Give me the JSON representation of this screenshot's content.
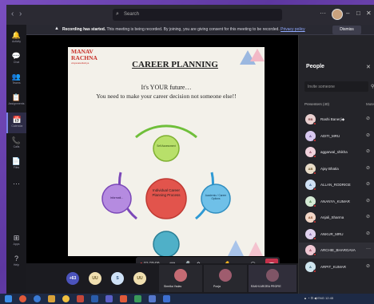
{
  "titlebar": {
    "search_placeholder": "Search"
  },
  "rail": [
    {
      "icon": "activity-icon",
      "glyph": "🔔",
      "label": "Activity"
    },
    {
      "icon": "chat-icon",
      "glyph": "💬",
      "label": "Chat"
    },
    {
      "icon": "teams-icon",
      "glyph": "👥",
      "label": "Teams"
    },
    {
      "icon": "assignments-icon",
      "glyph": "📋",
      "label": "Assignments"
    },
    {
      "icon": "calendar-icon",
      "glyph": "📅",
      "label": "Calendar"
    },
    {
      "icon": "calls-icon",
      "glyph": "📞",
      "label": "Calls"
    },
    {
      "icon": "files-icon",
      "glyph": "📄",
      "label": "Files"
    },
    {
      "icon": "more-icon",
      "glyph": "···",
      "label": ""
    },
    {
      "icon": "apps-icon",
      "glyph": "⊞",
      "label": "Apps"
    },
    {
      "icon": "help-icon",
      "glyph": "?",
      "label": "Help"
    }
  ],
  "banner": {
    "bold": "Recording has started.",
    "text": " This meeting is being recorded. By joining, you are giving consent for this meeting to be recorded.",
    "link": "Privacy policy",
    "dismiss": "Dismiss"
  },
  "slide": {
    "logo_line1": "MANAV",
    "logo_line2": "RACHNA",
    "logo_tag": "vidyanatarikshya",
    "title": "CAREER PLANNING",
    "subtitle1": "It's YOUR future…",
    "subtitle2": "You need to make your career decision not someone else!!",
    "center": "Individual Career Planning Process",
    "node_top": "Self Assessment",
    "node_right": "Academic / Career Options",
    "node_left": "Informati..."
  },
  "call": {
    "timer": "01:23:09",
    "presenter_label": "RAKHI ARORA PROFIE"
  },
  "strip": {
    "circles": [
      {
        "text": "+63",
        "bg": "#4b53bc",
        "fg": "#ffffff"
      },
      {
        "text": "UU",
        "bg": "#f0dfb0",
        "fg": "#6b5a2b"
      },
      {
        "text": "S",
        "bg": "#cfe2f7",
        "fg": "#2b4f7a"
      },
      {
        "text": "UU",
        "bg": "#f0dfb0",
        "fg": "#6b5a2b"
      }
    ],
    "tiles": [
      "Simrika Yadav",
      "Pooja",
      "RAKHI ARORA PROFIE"
    ]
  },
  "people": {
    "title": "People",
    "invite_placeholder": "Invite someone",
    "presenters_header": "Presenters (40)",
    "mute_all": "Mute all",
    "list": [
      {
        "initials": "RB",
        "name": "Rashi Banerji◆",
        "bg": "#e9d0d0",
        "fg": "#7a3a3a"
      },
      {
        "initials": "A",
        "name": "ADITI_MRU",
        "bg": "#d8c8ef",
        "fg": "#4b3576"
      },
      {
        "initials": "A",
        "name": "aggarwal_shikha",
        "bg": "#f1d2dc",
        "fg": "#7a2e4a"
      },
      {
        "initials": "AB",
        "name": "Ajay Bhatia",
        "bg": "#e8dcc8",
        "fg": "#6b5226"
      },
      {
        "initials": "A",
        "name": "ALLAN_RODRIGE",
        "bg": "#cfe0f4",
        "fg": "#284d7b"
      },
      {
        "initials": "A",
        "name": "ANANYA_KUMAR",
        "bg": "#d4ead4",
        "fg": "#2e6a2e"
      },
      {
        "initials": "AS",
        "name": "Anjali_Sharma",
        "bg": "#f2d6c6",
        "fg": "#7d3f1a"
      },
      {
        "initials": "A",
        "name": "ANKUR_MRU",
        "bg": "#e0d2ee",
        "fg": "#5a3a80"
      },
      {
        "initials": "A",
        "name": "ARCHIE_BHARGAVA",
        "bg": "#f0c8d4",
        "fg": "#7c2240"
      },
      {
        "initials": "A",
        "name": "ARPIT_KUMAR",
        "bg": "#cfe5ee",
        "fg": "#24566a"
      }
    ]
  },
  "tray": {
    "time": "12:45"
  }
}
